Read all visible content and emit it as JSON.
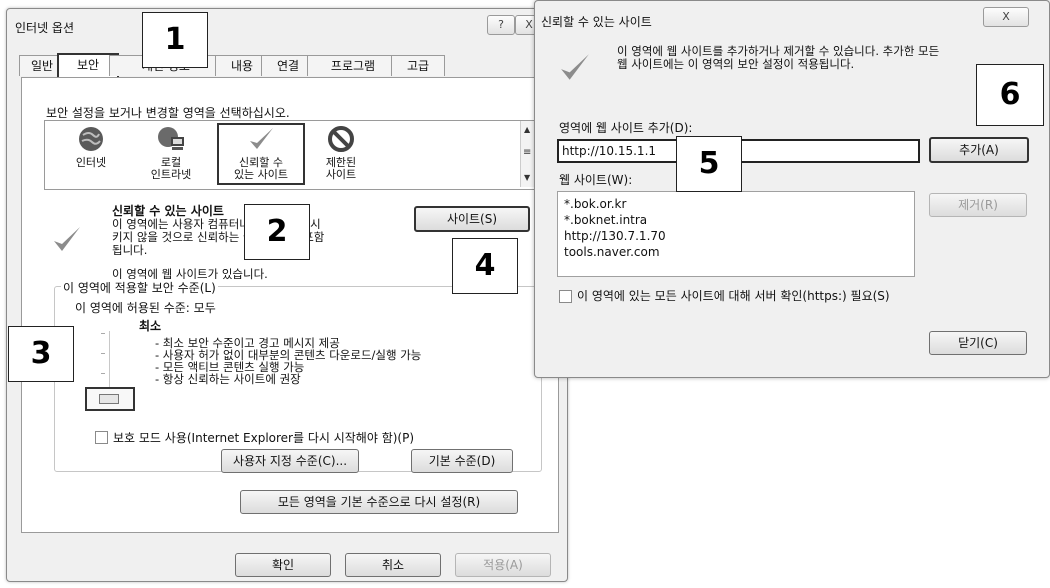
{
  "internet_options": {
    "title": "인터넷 옵션",
    "help_glyph": "?",
    "close_glyph": "X",
    "tabs": [
      "일반",
      "보안",
      "개인 정보",
      "내용",
      "연결",
      "프로그램",
      "고급"
    ],
    "instruction": "보안 설정을 보거나 변경할 영역을 선택하십시오.",
    "zones": [
      {
        "label": "인터넷",
        "icon": "globe-icon"
      },
      {
        "label": "로컬\n인트라넷",
        "icon": "intranet-icon"
      },
      {
        "label": "신뢰할 수\n있는 사이트",
        "icon": "check-icon"
      },
      {
        "label": "제한된\n사이트",
        "icon": "restricted-icon"
      }
    ],
    "zone_heading": "신뢰할 수 있는 사이트",
    "zone_desc": "이 영역에는 사용자 컴퓨터나 파일을 손상시\n키지 않을 것으로 신뢰하는 웹 사이트가 포함\n됩니다.",
    "zone_has_sites": "이 영역에 웹 사이트가 있습니다.",
    "sites_button": "사이트(S)",
    "security_level_legend": "이 영역에 적용할 보안 수준(L)",
    "allowed_levels": "이 영역에 허용된 수준: 모두",
    "level_name": "최소",
    "level_details": [
      "- 최소 보안 수준이고 경고 메시지 제공",
      "- 사용자 허가 없이 대부분의 콘텐츠 다운로드/실행 가능",
      "- 모든 액티브 콘텐츠 실행 가능",
      "- 항상 신뢰하는 사이트에 권장"
    ],
    "protected_mode": "보호 모드 사용(Internet Explorer를 다시 시작해야 함)(P)",
    "custom_level_button": "사용자 지정 수준(C)...",
    "default_level_button": "기본 수준(D)",
    "reset_all_button": "모든 영역을 기본 수준으로 다시 설정(R)",
    "ok_button": "확인",
    "cancel_button": "취소",
    "apply_button": "적용(A)"
  },
  "trusted_sites": {
    "title": "신뢰할 수 있는 사이트",
    "close_glyph": "X",
    "info": "이 영역에 웹 사이트를 추가하거나 제거할 수 있습니다. 추가한 모든\n웹 사이트에는 이 영역의 보안 설정이 적용됩니다.",
    "add_label": "영역에 웹 사이트 추가(D):",
    "add_value": "http://10.15.1.1",
    "add_button": "추가(A)",
    "websites_label": "웹 사이트(W):",
    "websites": [
      "*.bok.or.kr",
      "*.boknet.intra",
      "http://130.7.1.70",
      "tools.naver.com"
    ],
    "remove_button": "제거(R)",
    "https_check": "이 영역에 있는 모든 사이트에 대해 서버 확인(https:) 필요(S)",
    "close_button": "닫기(C)"
  },
  "callouts": [
    "1",
    "2",
    "3",
    "4",
    "5",
    "6"
  ]
}
